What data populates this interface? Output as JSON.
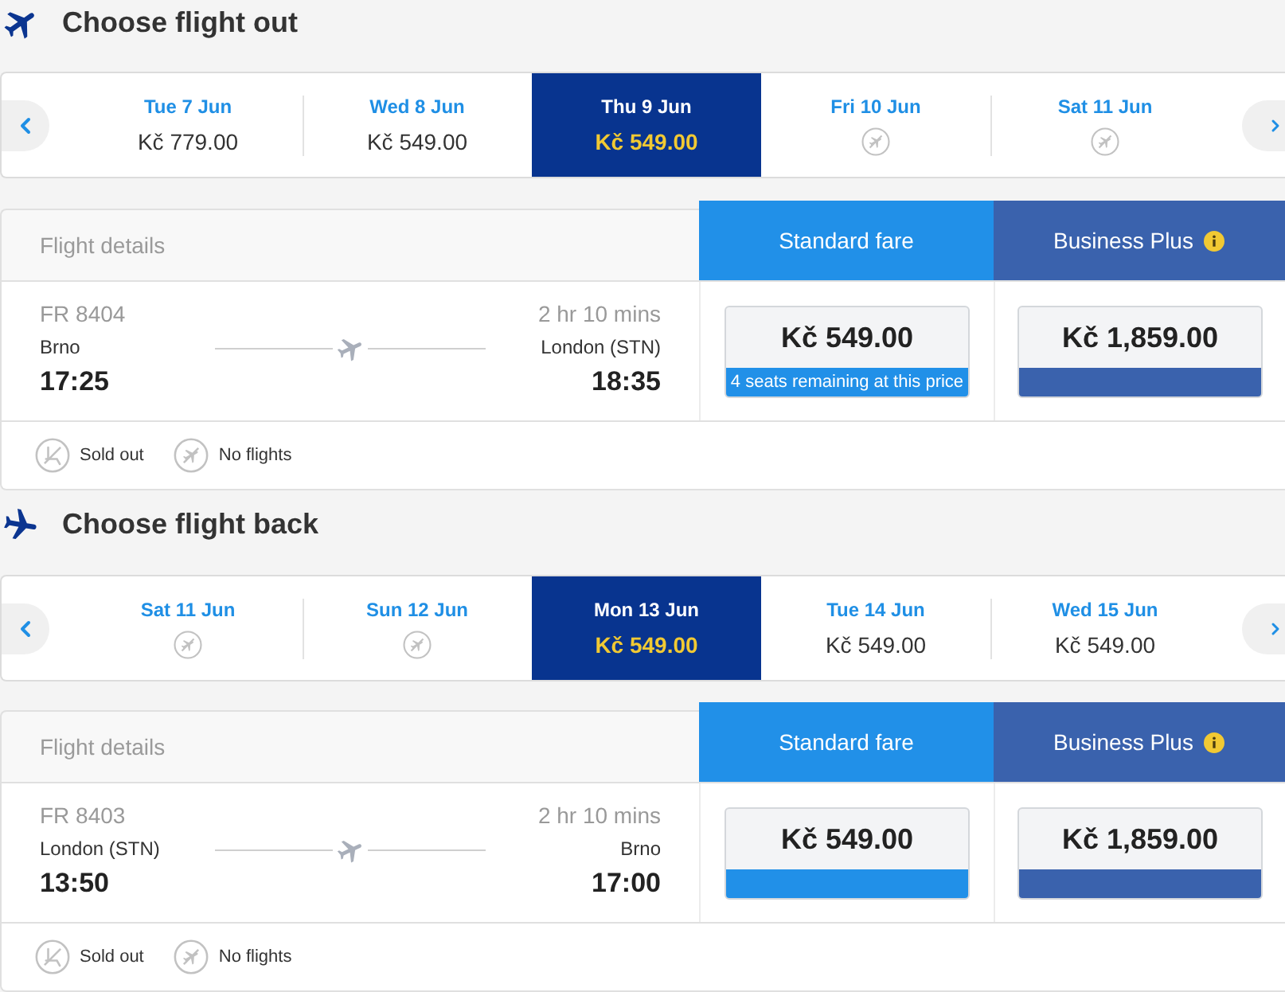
{
  "sections": [
    {
      "kind": "outbound",
      "title": "Choose flight out",
      "dates": [
        {
          "label": "Tue 7 Jun",
          "kind": "price",
          "price": "Kč 779.00",
          "selected": false
        },
        {
          "label": "Wed 8 Jun",
          "kind": "price",
          "price": "Kč 549.00",
          "selected": false
        },
        {
          "label": "Thu 9 Jun",
          "kind": "price",
          "price": "Kč 549.00",
          "selected": true
        },
        {
          "label": "Fri 10 Jun",
          "kind": "no_flights",
          "selected": false
        },
        {
          "label": "Sat 11 Jun",
          "kind": "no_flights",
          "selected": false
        }
      ],
      "columns": [
        {
          "kind": "details",
          "label": "Flight details"
        },
        {
          "kind": "standard",
          "label": "Standard fare",
          "info": false
        },
        {
          "kind": "business",
          "label": "Business Plus",
          "info": true
        }
      ],
      "flight": {
        "number": "FR 8404",
        "duration": "2 hr 10 mins",
        "origin": "Brno",
        "destination": "London (STN)",
        "departure": "17:25",
        "arrival": "18:35"
      },
      "fares": [
        {
          "kind": "standard",
          "price": "Kč 549.00",
          "note": "4 seats remaining at this price"
        },
        {
          "kind": "business",
          "price": "Kč 1,859.00"
        }
      ],
      "legend": [
        {
          "kind": "sold_out",
          "label": "Sold out"
        },
        {
          "kind": "no_flights",
          "label": "No flights"
        }
      ]
    },
    {
      "kind": "return",
      "title": "Choose flight back",
      "dates": [
        {
          "label": "Sat 11 Jun",
          "kind": "no_flights",
          "selected": false
        },
        {
          "label": "Sun 12 Jun",
          "kind": "no_flights",
          "selected": false
        },
        {
          "label": "Mon 13 Jun",
          "kind": "price",
          "price": "Kč 549.00",
          "selected": true
        },
        {
          "label": "Tue 14 Jun",
          "kind": "price",
          "price": "Kč 549.00",
          "selected": false
        },
        {
          "label": "Wed 15 Jun",
          "kind": "price",
          "price": "Kč 549.00",
          "selected": false
        }
      ],
      "columns": [
        {
          "kind": "details",
          "label": "Flight details"
        },
        {
          "kind": "standard",
          "label": "Standard fare",
          "info": false
        },
        {
          "kind": "business",
          "label": "Business Plus",
          "info": true
        }
      ],
      "flight": {
        "number": "FR 8403",
        "duration": "2 hr 10 mins",
        "origin": "London (STN)",
        "destination": "Brno",
        "departure": "13:50",
        "arrival": "17:00"
      },
      "fares": [
        {
          "kind": "standard",
          "price": "Kč 549.00"
        },
        {
          "kind": "business",
          "price": "Kč 1,859.00"
        }
      ],
      "legend": [
        {
          "kind": "sold_out",
          "label": "Sold out"
        },
        {
          "kind": "no_flights",
          "label": "No flights"
        }
      ]
    }
  ]
}
